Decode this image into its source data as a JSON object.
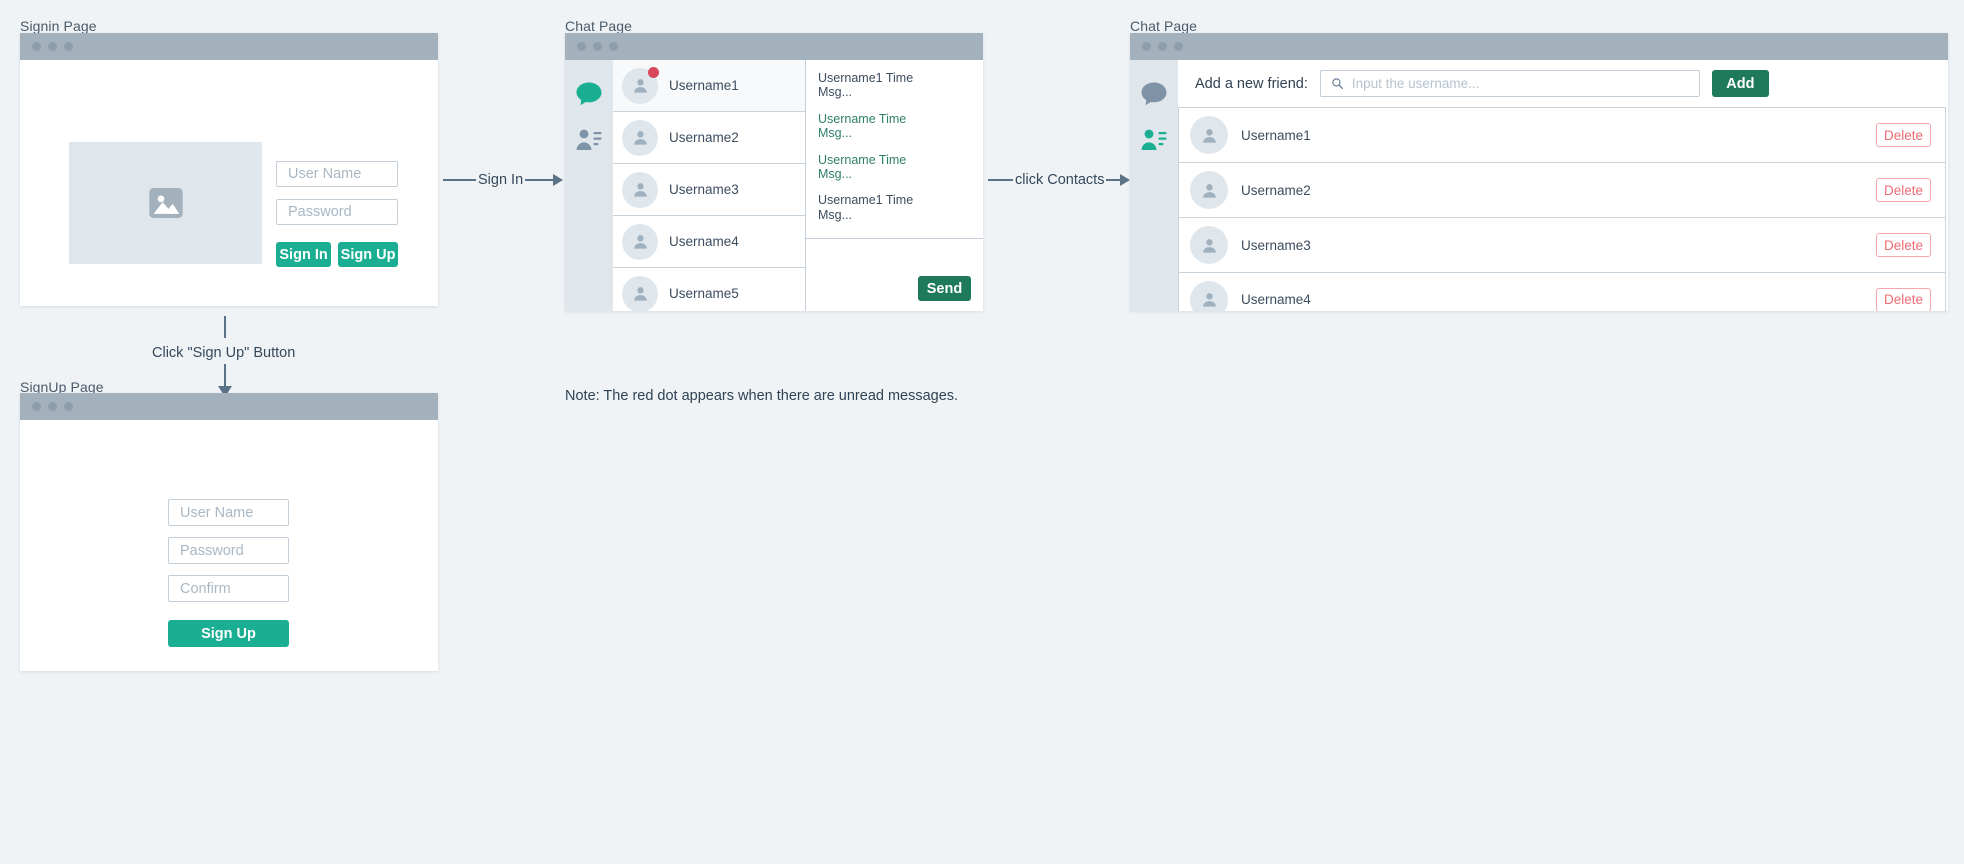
{
  "frames": {
    "signin": {
      "label": "Signin Page"
    },
    "signup": {
      "label": "SignUp Page"
    },
    "chat": {
      "label": "Chat Page"
    },
    "contacts": {
      "label": "Chat Page"
    }
  },
  "signin": {
    "username_placeholder": "User Name",
    "password_placeholder": "Password",
    "signin_button": "Sign In",
    "signup_button": "Sign Up",
    "image_icon": "image-placeholder-icon"
  },
  "signup": {
    "username_placeholder": "User Name",
    "password_placeholder": "Password",
    "confirm_placeholder": "Confirm",
    "submit_button": "Sign Up"
  },
  "transitions": {
    "sign_in": "Sign In",
    "click_signup": "Click \"Sign Up\" Button",
    "click_contacts": "click Contacts"
  },
  "chat": {
    "rail": [
      {
        "icon": "chat-bubble-icon",
        "active": true
      },
      {
        "icon": "contacts-icon",
        "active": false
      }
    ],
    "users": [
      {
        "name": "Username1",
        "unread": true,
        "active": true
      },
      {
        "name": "Username2",
        "unread": false,
        "active": false
      },
      {
        "name": "Username3",
        "unread": false,
        "active": false
      },
      {
        "name": "Username4",
        "unread": false,
        "active": false
      },
      {
        "name": "Username5",
        "unread": false,
        "active": false
      }
    ],
    "messages": [
      {
        "header": "Username1 Time",
        "body": "Msg...",
        "direction": "in"
      },
      {
        "header": "Username Time",
        "body": "Msg...",
        "direction": "out"
      },
      {
        "header": "Username Time",
        "body": "Msg...",
        "direction": "out"
      },
      {
        "header": "Username1 Time",
        "body": "Msg...",
        "direction": "in"
      }
    ],
    "send_button": "Send",
    "note": "Note: The red dot appears when there are unread messages."
  },
  "contacts": {
    "rail": [
      {
        "icon": "chat-bubble-icon",
        "active": false
      },
      {
        "icon": "contacts-icon",
        "active": true
      }
    ],
    "add_label": "Add a new friend:",
    "search_placeholder": "Input the username...",
    "search_icon": "search-icon",
    "add_button": "Add",
    "delete_button": "Delete",
    "rows": [
      {
        "name": "Username1"
      },
      {
        "name": "Username2"
      },
      {
        "name": "Username3"
      },
      {
        "name": "Username4"
      }
    ]
  },
  "colors": {
    "teal": "#1aae92",
    "green": "#1f7a5c",
    "red_dot": "#d9475b",
    "delete_red": "#ef6b75",
    "titlebar": "#a3b1bd",
    "canvas": "#f0f3f5"
  }
}
